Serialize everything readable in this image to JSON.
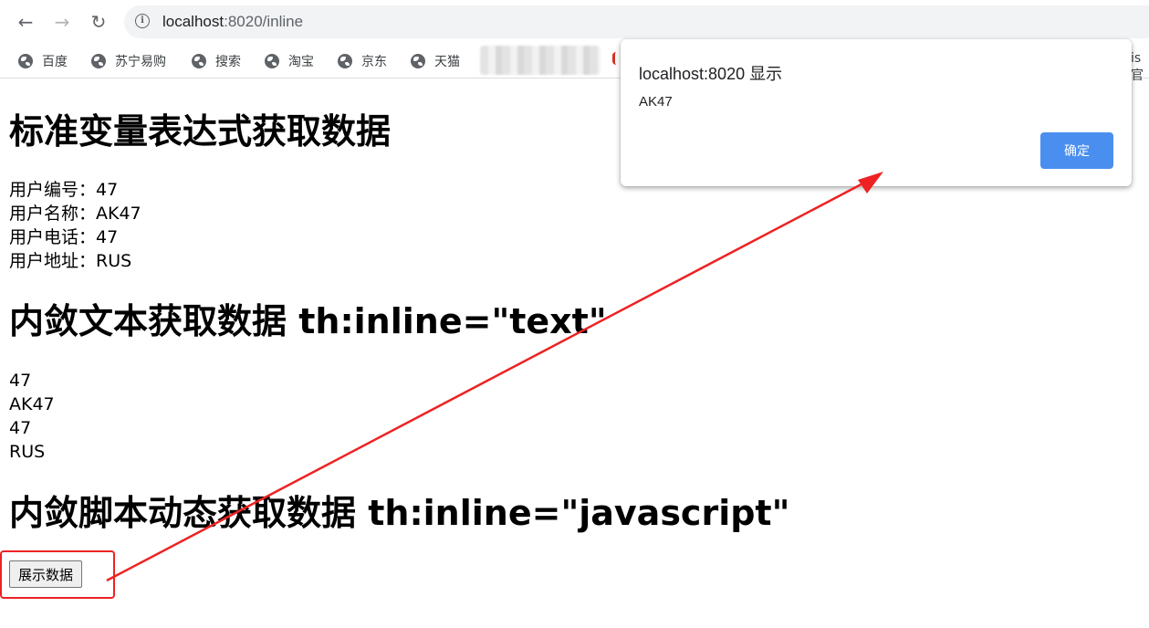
{
  "browser": {
    "nav": {
      "back": "←",
      "forward": "→",
      "reload": "↻"
    },
    "url_host": "localhost",
    "url_path": ":8020/inline",
    "bookmarks": [
      "百度",
      "苏宁易购",
      "搜索",
      "淘宝",
      "京东",
      "天猫"
    ],
    "bookmark_partial": "is官"
  },
  "page": {
    "section1_title": "标准变量表达式获取数据",
    "user_lines": [
      "用户编号：47",
      "用户名称：AK47",
      "用户电话：47",
      "用户地址：RUS"
    ],
    "section2_title": "内敛文本获取数据 th:inline=\"text\"",
    "inline_values": [
      "47",
      "AK47",
      "47",
      "RUS"
    ],
    "section3_title": "内敛脚本动态获取数据 th:inline=\"javascript\"",
    "show_button": "展示数据"
  },
  "dialog": {
    "title": "localhost:8020 显示",
    "message": "AK47",
    "ok_label": "确定"
  },
  "colors": {
    "accent_button": "#4a8ff0",
    "annotation_red": "#ee2222"
  }
}
